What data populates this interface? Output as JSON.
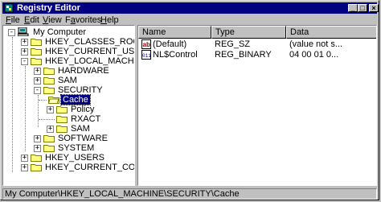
{
  "window": {
    "title": "Registry Editor"
  },
  "title_buttons": {
    "minimize": "_",
    "maximize": "□",
    "close": "×"
  },
  "menu": [
    {
      "label": "File",
      "accel": "F",
      "rest": "ile"
    },
    {
      "label": "Edit",
      "accel": "E",
      "rest": "dit"
    },
    {
      "label": "View",
      "accel": "V",
      "rest": "iew"
    },
    {
      "label": "Favorites",
      "accel": "a",
      "pre": "F",
      "rest": "vorites"
    },
    {
      "label": "Help",
      "accel": "H",
      "rest": "elp"
    }
  ],
  "tree": {
    "root": "My Computer",
    "hkcr": "HKEY_CLASSES_ROOT",
    "hkcu": "HKEY_CURRENT_USER",
    "hklm": "HKEY_LOCAL_MACHINE",
    "hardware": "HARDWARE",
    "sam": "SAM",
    "security": "SECURITY",
    "cache": "Cache",
    "policy": "Policy",
    "rxact": "RXACT",
    "sam2": "SAM",
    "software": "SOFTWARE",
    "system": "SYSTEM",
    "hku": "HKEY_USERS",
    "hkcc": "HKEY_CURRENT_CONFIG"
  },
  "list": {
    "columns": {
      "name": "Name",
      "type": "Type",
      "data": "Data"
    },
    "rows": [
      {
        "name": "(Default)",
        "type": "REG_SZ",
        "data": "(value not s...",
        "icon": "string-value-icon"
      },
      {
        "name": "NL$Control",
        "type": "REG_BINARY",
        "data": "04 00 01 0...",
        "icon": "binary-value-icon"
      }
    ]
  },
  "status": {
    "path": "My Computer\\HKEY_LOCAL_MACHINE\\SECURITY\\Cache"
  },
  "colors": {
    "title_bg": "#000080",
    "window_bg": "#c0c0c0",
    "selection": "#000080",
    "folder": "#ffff80"
  }
}
